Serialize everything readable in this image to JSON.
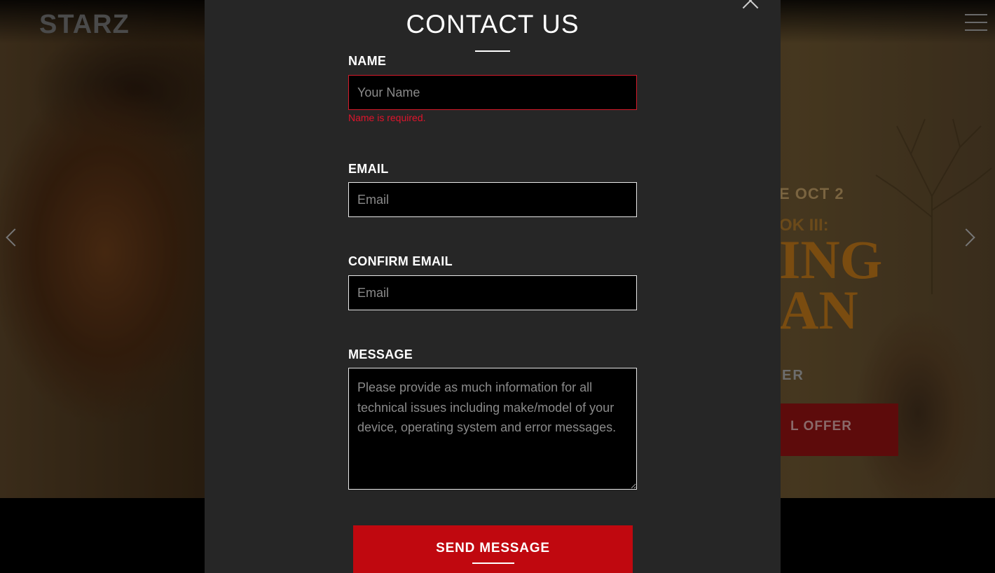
{
  "header": {
    "logo_text": "STARZ",
    "menu_icon": "hamburger-menu-icon"
  },
  "hero": {
    "date_text": "E OCT 2",
    "book_text": "OK III:",
    "title_line1": "ING",
    "title_line2": "AN",
    "tagline_fragment": "ER",
    "cta_label": "L OFFER",
    "prev_icon": "chevron-left-icon",
    "next_icon": "chevron-right-icon"
  },
  "modal": {
    "title": "CONTACT US",
    "close_icon": "close-icon",
    "name": {
      "label": "NAME",
      "placeholder": "Your Name",
      "value": "",
      "error": "Name is required."
    },
    "email": {
      "label": "EMAIL",
      "placeholder": "Email",
      "value": ""
    },
    "confirm_email": {
      "label": "CONFIRM EMAIL",
      "placeholder": "Email",
      "value": ""
    },
    "message": {
      "label": "MESSAGE",
      "placeholder": "Please provide as much information for all technical issues including make/model of your device, operating system and error messages.",
      "value": ""
    },
    "submit_label": "SEND MESSAGE"
  },
  "colors": {
    "modal_bg": "#262626",
    "button_red": "#c0080f",
    "error_red": "#e0142c",
    "input_bg": "#000000"
  }
}
